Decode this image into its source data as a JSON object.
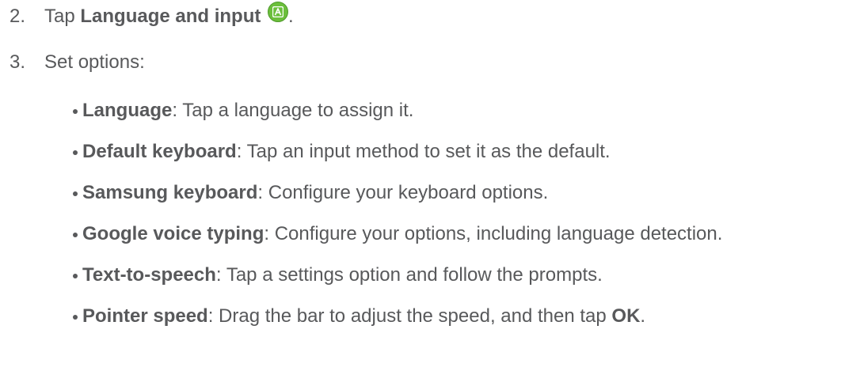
{
  "steps": [
    {
      "number": "2.",
      "prefix": "Tap ",
      "bold": "Language and input",
      "suffix": ".",
      "icon": "language-and-input-app-icon"
    },
    {
      "number": "3.",
      "text": "Set options:"
    }
  ],
  "options": [
    {
      "term": "Language",
      "desc": ": Tap a language to assign it."
    },
    {
      "term": "Default keyboard",
      "desc": ": Tap an input method to set it as the default."
    },
    {
      "term": "Samsung keyboard",
      "desc": ": Configure your keyboard options."
    },
    {
      "term": "Google voice typing",
      "desc": ": Configure your options, including language detection."
    },
    {
      "term": "Text-to-speech",
      "desc": ": Tap a settings option and follow the prompts."
    },
    {
      "term": "Pointer speed",
      "desc": ": Drag the bar to adjust the speed, and then tap ",
      "bold_end": "OK",
      "end": "."
    }
  ],
  "colors": {
    "text": "#58595b",
    "icon_green": "#6cbf3c"
  }
}
